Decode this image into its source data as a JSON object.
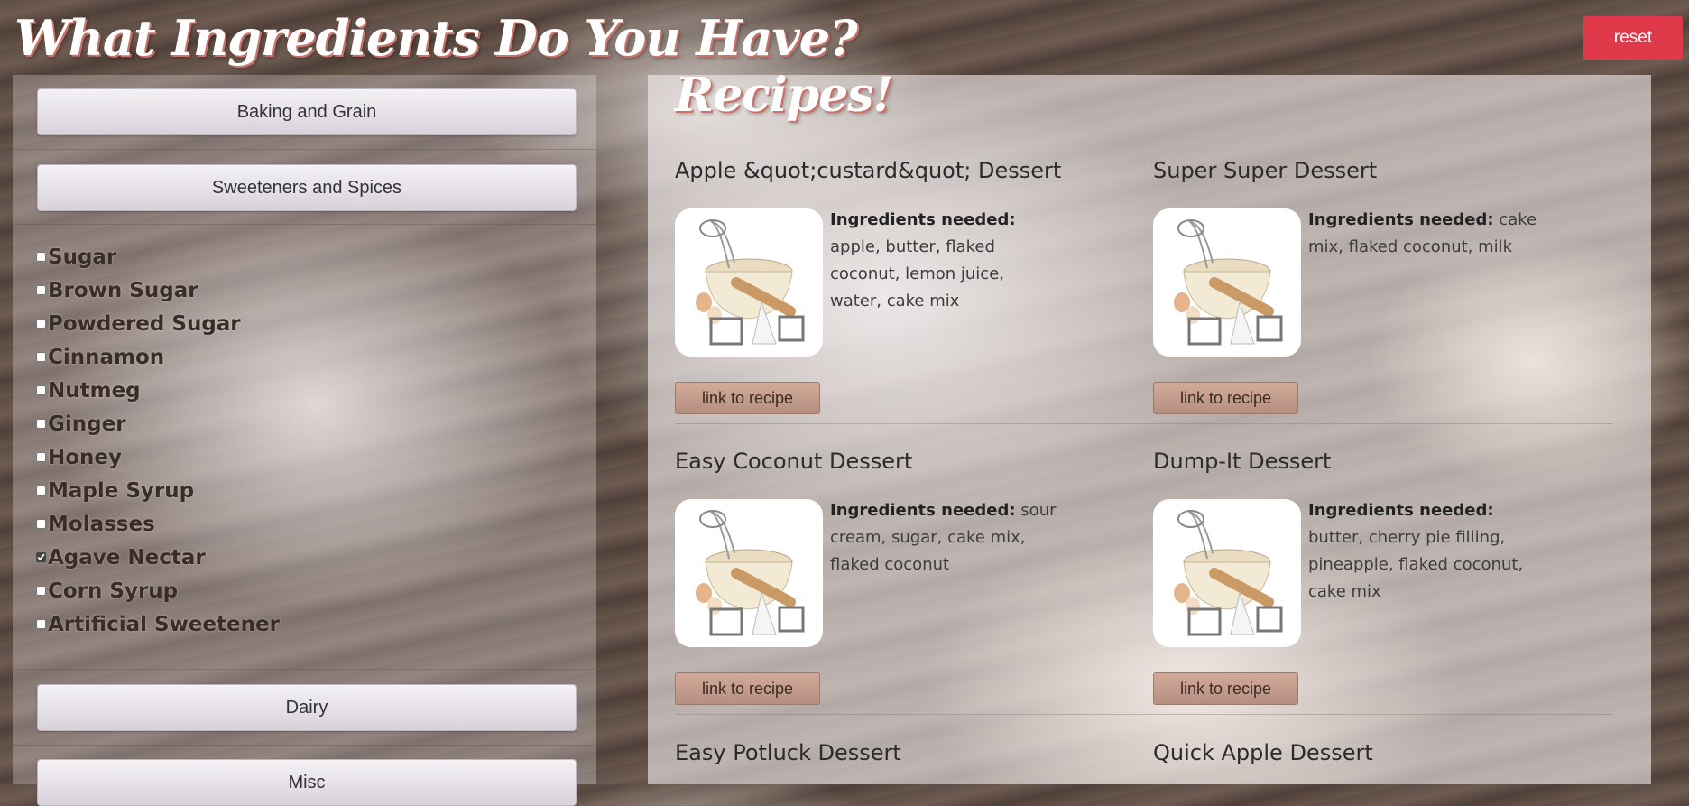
{
  "page": {
    "title": "What Ingredients Do You Have?",
    "reset_label": "reset"
  },
  "categories": [
    {
      "label": "Baking and Grain"
    },
    {
      "label": "Sweeteners and Spices"
    },
    {
      "label": "Dairy"
    },
    {
      "label": "Misc"
    }
  ],
  "sweeteners": [
    {
      "label": "Sugar",
      "checked": false
    },
    {
      "label": "Brown Sugar",
      "checked": false
    },
    {
      "label": "Powdered Sugar",
      "checked": false
    },
    {
      "label": "Cinnamon",
      "checked": false
    },
    {
      "label": "Nutmeg",
      "checked": false
    },
    {
      "label": "Ginger",
      "checked": false
    },
    {
      "label": "Honey",
      "checked": false
    },
    {
      "label": "Maple Syrup",
      "checked": false
    },
    {
      "label": "Molasses",
      "checked": false
    },
    {
      "label": "Agave Nectar",
      "checked": true
    },
    {
      "label": "Corn Syrup",
      "checked": false
    },
    {
      "label": "Artificial Sweetener",
      "checked": false
    }
  ],
  "recipes_heading": "Recipes!",
  "ingredients_label": "Ingredients needed:",
  "link_label": "link to recipe",
  "recipes": [
    {
      "title": "Apple &quot;custard&quot; Dessert",
      "ingredients": "apple, butter, flaked coconut, lemon juice, water, cake mix"
    },
    {
      "title": "Super Super Dessert",
      "ingredients": "cake mix, flaked coconut, milk"
    },
    {
      "title": "Easy Coconut Dessert",
      "ingredients": "sour cream, sugar, cake mix, flaked coconut"
    },
    {
      "title": "Dump-It Dessert",
      "ingredients": "butter, cherry pie filling, pineapple, flaked coconut, cake mix"
    },
    {
      "title": "Easy Potluck Dessert",
      "ingredients": ""
    },
    {
      "title": "Quick Apple Dessert",
      "ingredients": ""
    }
  ],
  "colors": {
    "reset": "#e03a4a",
    "link_button": "#c69e8e",
    "title_shadow": "#c9736a"
  }
}
